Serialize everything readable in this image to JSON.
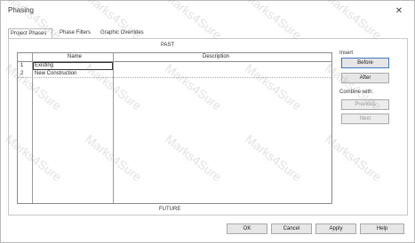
{
  "window": {
    "title": "Phasing",
    "close_glyph": "✕"
  },
  "tabs": [
    {
      "label": "Project Phases"
    },
    {
      "label": "Phase Filters"
    },
    {
      "label": "Graphic Overrides"
    }
  ],
  "grid": {
    "top_label": "PAST",
    "bottom_label": "FUTURE",
    "columns": [
      "",
      "Name",
      "Description"
    ],
    "rows": [
      {
        "num": "1",
        "name": "Existing",
        "description": ""
      },
      {
        "num": "2",
        "name": "New Construction",
        "description": ""
      }
    ]
  },
  "side": {
    "insert_label": "Insert",
    "before_label": "Before",
    "after_label": "After",
    "combine_label": "Combine with:",
    "previous_label": "Previous",
    "next_label": "Next"
  },
  "footer": {
    "ok_label": "OK",
    "cancel_label": "Cancel",
    "apply_label": "Apply",
    "help_label": "Help"
  },
  "watermark_text": "Marks4Sure"
}
